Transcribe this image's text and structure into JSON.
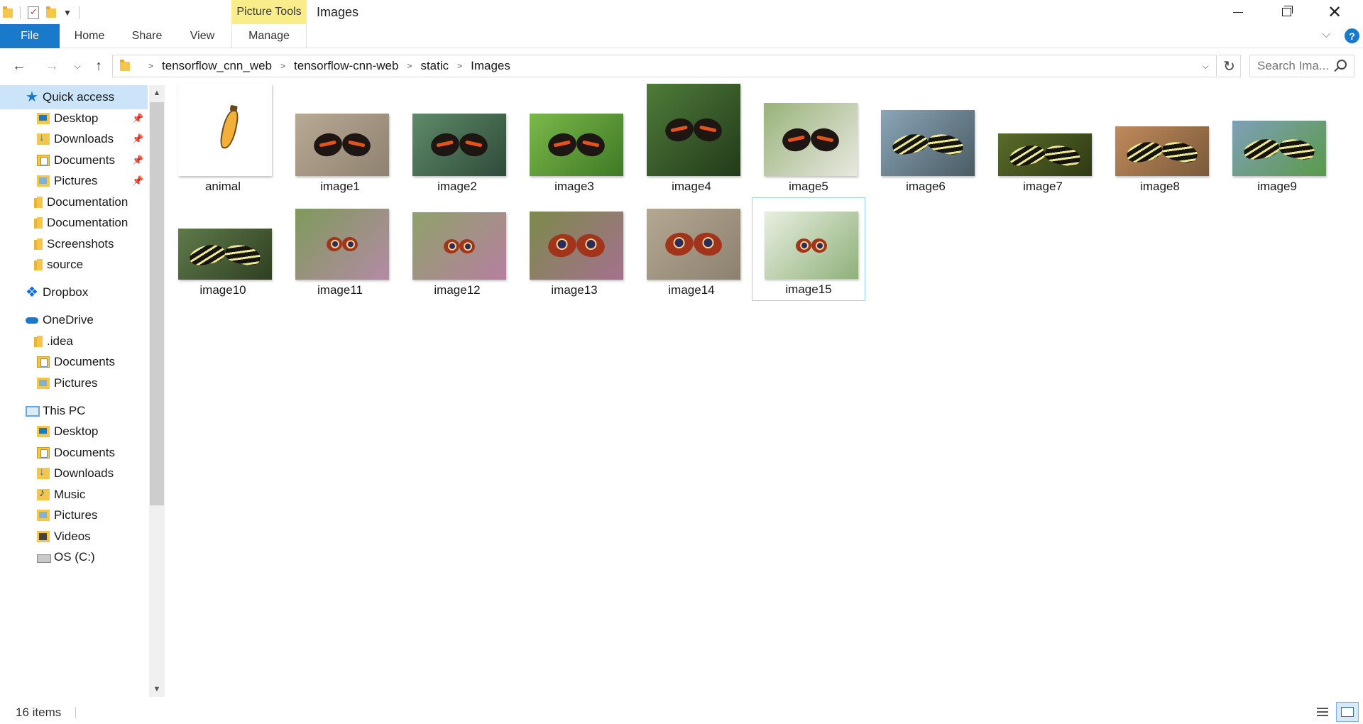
{
  "window": {
    "title": "Images",
    "contextual_tab": "Picture Tools"
  },
  "ribbon": {
    "tabs": [
      {
        "label": "File"
      },
      {
        "label": "Home"
      },
      {
        "label": "Share"
      },
      {
        "label": "View"
      },
      {
        "label": "Manage"
      }
    ]
  },
  "address": {
    "crumbs": [
      "tensorflow_cnn_web",
      "tensorflow-cnn-web",
      "static",
      "Images"
    ]
  },
  "search": {
    "placeholder": "Search Ima..."
  },
  "sidebar": {
    "items": [
      {
        "label": "Quick access",
        "icon": "star-icon",
        "selected": true
      },
      {
        "label": "Desktop",
        "icon": "desktop-folder-icon",
        "pinned": true
      },
      {
        "label": "Downloads",
        "icon": "downloads-folder-icon",
        "pinned": true
      },
      {
        "label": "Documents",
        "icon": "documents-folder-icon",
        "pinned": true
      },
      {
        "label": "Pictures",
        "icon": "pictures-folder-icon",
        "pinned": true
      },
      {
        "label": "Documentation",
        "icon": "folder-icon"
      },
      {
        "label": "Documentation",
        "icon": "folder-icon"
      },
      {
        "label": "Screenshots",
        "icon": "folder-icon"
      },
      {
        "label": "source",
        "icon": "folder-icon"
      },
      {
        "label": "Dropbox",
        "icon": "dropbox-icon"
      },
      {
        "label": "OneDrive",
        "icon": "onedrive-icon"
      },
      {
        "label": ".idea",
        "icon": "folder-icon"
      },
      {
        "label": "Documents",
        "icon": "documents-folder-icon"
      },
      {
        "label": "Pictures",
        "icon": "pictures-folder-icon"
      },
      {
        "label": "This PC",
        "icon": "computer-icon"
      },
      {
        "label": "Desktop",
        "icon": "desktop-folder-icon"
      },
      {
        "label": "Documents",
        "icon": "documents-folder-icon"
      },
      {
        "label": "Downloads",
        "icon": "downloads-folder-icon"
      },
      {
        "label": "Music",
        "icon": "music-folder-icon"
      },
      {
        "label": "Pictures",
        "icon": "pictures-folder-icon"
      },
      {
        "label": "Videos",
        "icon": "videos-folder-icon"
      },
      {
        "label": "OS (C:)",
        "icon": "drive-icon"
      }
    ]
  },
  "files": [
    {
      "name": "animal",
      "kind": "banana-logo"
    },
    {
      "name": "image1",
      "kind": "red-admiral"
    },
    {
      "name": "image2",
      "kind": "red-admiral"
    },
    {
      "name": "image3",
      "kind": "red-admiral"
    },
    {
      "name": "image4",
      "kind": "red-admiral"
    },
    {
      "name": "image5",
      "kind": "red-admiral"
    },
    {
      "name": "image6",
      "kind": "zebra-longwing"
    },
    {
      "name": "image7",
      "kind": "zebra-longwing"
    },
    {
      "name": "image8",
      "kind": "zebra-longwing"
    },
    {
      "name": "image9",
      "kind": "zebra-longwing"
    },
    {
      "name": "image10",
      "kind": "zebra-longwing"
    },
    {
      "name": "image11",
      "kind": "peacock"
    },
    {
      "name": "image12",
      "kind": "peacock"
    },
    {
      "name": "image13",
      "kind": "peacock"
    },
    {
      "name": "image14",
      "kind": "peacock"
    },
    {
      "name": "image15",
      "kind": "peacock",
      "selected": true
    }
  ],
  "status": {
    "item_count": "16 items"
  },
  "colors": {
    "accent": "#1979ca",
    "selection": "#cce4f7",
    "picture_tools": "#f8ed8a"
  }
}
